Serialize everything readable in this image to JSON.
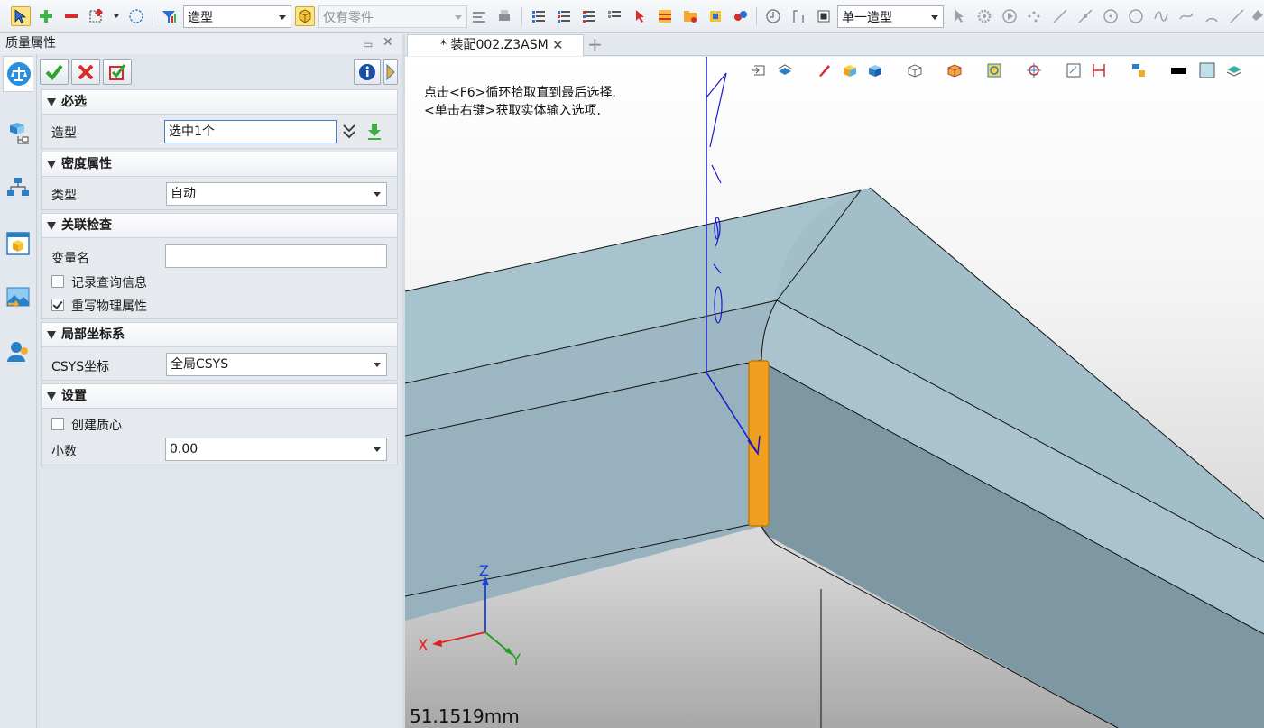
{
  "toolbar": {
    "filter_combo": "造型",
    "scope_combo": "仅有零件",
    "pick_combo": "单一造型",
    "icons": [
      "select-icon",
      "add-icon",
      "remove-icon",
      "box-select-icon",
      "lasso-icon",
      "filter-icon",
      "part-filter-icon"
    ]
  },
  "panel": {
    "title": "质量属性",
    "sections": {
      "required": {
        "title": "必选",
        "shape_label": "造型",
        "shape_value": "选中1个"
      },
      "density": {
        "title": "密度属性",
        "type_label": "类型",
        "type_value": "自动"
      },
      "check": {
        "title": "关联检查",
        "varname_label": "变量名",
        "varname_value": "",
        "record_label": "记录查询信息",
        "record_checked": false,
        "rewrite_label": "重写物理属性",
        "rewrite_checked": true
      },
      "csys": {
        "title": "局部坐标系",
        "csys_label": "CSYS坐标",
        "csys_value": "全局CSYS"
      },
      "settings": {
        "title": "设置",
        "centroid_label": "创建质心",
        "centroid_checked": false,
        "decimal_label": "小数",
        "decimal_value": "0.00"
      }
    }
  },
  "document": {
    "tab_label": "* 装配002.Z3ASM",
    "close_glyph": "✕",
    "new_glyph": "+"
  },
  "viewport": {
    "hint_line1": "点击<F6>循环拾取直到最后选择.",
    "hint_line2": "<单击右键>获取实体输入选项.",
    "measurement": "51.1519mm",
    "axis_x": "X",
    "axis_y": "Y",
    "axis_z": "Z",
    "colors": {
      "solid_top": "#a4c1cc",
      "solid_side": "#7f9aa5",
      "highlight": "#f0a020",
      "axis_x": "#e02020",
      "axis_y": "#20a020",
      "axis_z": "#1a3fd6"
    }
  }
}
